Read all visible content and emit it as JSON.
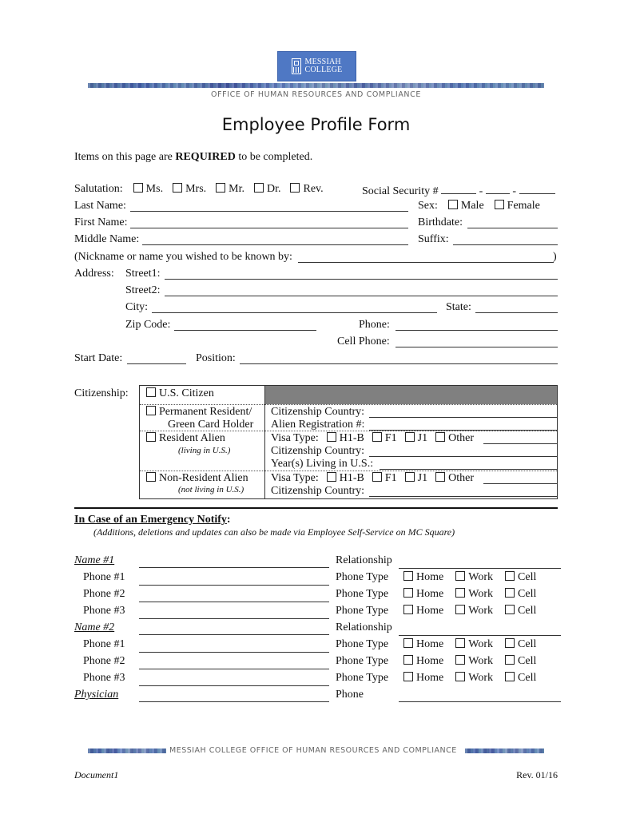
{
  "header": {
    "logo_line1": "MESSIAH",
    "logo_line2": "COLLEGE",
    "office_name": "OFFICE OF HUMAN RESOURCES AND COMPLIANCE",
    "title": "Employee Profile Form"
  },
  "intro": {
    "prefix": "Items on this page are ",
    "bold": "REQUIRED",
    "suffix": " to be completed."
  },
  "personal": {
    "salutation_label": "Salutation:",
    "salutations": [
      "Ms.",
      "Mrs.",
      "Mr.",
      "Dr.",
      "Rev."
    ],
    "ssn_label": "Social Security #",
    "ssn_sep": "-",
    "last_name_label": "Last Name:",
    "sex_label": "Sex:",
    "sex_options": [
      "Male",
      "Female"
    ],
    "first_name_label": "First Name:",
    "birthdate_label": "Birthdate:",
    "middle_name_label": "Middle Name:",
    "suffix_label": "Suffix:",
    "nickname_label": "(Nickname or name you wished to be known by:",
    "nickname_close": ")",
    "address_label": "Address:",
    "street1_label": "Street1:",
    "street2_label": "Street2:",
    "city_label": "City:",
    "state_label": "State:",
    "zip_label": "Zip Code:",
    "phone_label": "Phone:",
    "cell_label": "Cell Phone:",
    "start_date_label": "Start Date:",
    "position_label": "Position:"
  },
  "citizenship": {
    "label": "Citizenship:",
    "us_citizen": "U.S. Citizen",
    "perm_res_line1": "Permanent Resident/",
    "perm_res_line2": "Green Card Holder",
    "perm_country": "Citizenship Country:",
    "perm_alien_reg": "Alien Registration #:",
    "res_alien": "Resident Alien",
    "res_alien_note": "(living in U.S.)",
    "visa_type": "Visa Type:",
    "visa_options": [
      "H1-B",
      "F1",
      "J1",
      "Other"
    ],
    "res_country": "Citizenship Country:",
    "res_years": "Year(s) Living in U.S.:",
    "nonres_alien": "Non-Resident Alien",
    "nonres_note": "(not living in U.S.)",
    "nonres_country": "Citizenship Country:"
  },
  "emergency": {
    "heading": "In Case of an Emergency Notify",
    "heading_colon": ":",
    "note": "(Additions, deletions and updates can also be made via Employee Self-Service on MC Square)",
    "name1": "Name #1",
    "name2": "Name #2",
    "physician": "Physician",
    "relationship": "Relationship",
    "phone_labels": [
      "Phone #1",
      "Phone #2",
      "Phone #3"
    ],
    "phone_type": "Phone Type",
    "phone_type_options": [
      "Home",
      "Work",
      "Cell"
    ],
    "phone": "Phone"
  },
  "footer": {
    "band_text": "MESSIAH COLLEGE OFFICE OF HUMAN RESOURCES AND COMPLIANCE",
    "doc_name": "Document1",
    "revision": "Rev. 01/16"
  }
}
